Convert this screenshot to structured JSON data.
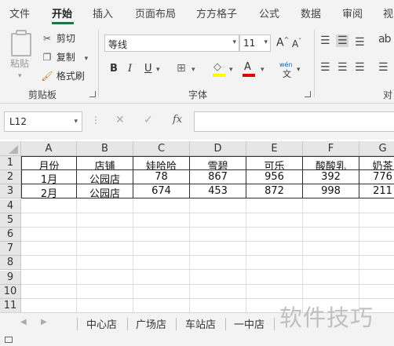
{
  "ribbon_tabs": [
    "文件",
    "开始",
    "插入",
    "页面布局",
    "方方格子",
    "公式",
    "数据",
    "审阅",
    "视"
  ],
  "clipboard": {
    "paste_label": "粘贴",
    "cut_label": "剪切",
    "copy_label": "复制",
    "format_painter_label": "格式刷",
    "group_label": "剪贴板"
  },
  "font": {
    "name": "等线",
    "size": "11",
    "group_label": "字体",
    "bold": "B",
    "italic": "I",
    "underline": "U",
    "grow": "A",
    "shrink": "A",
    "phonetic": "wén"
  },
  "alignment": {
    "group_label": "对"
  },
  "formula_bar": {
    "name_box": "L12",
    "fx_label": "fx",
    "value": ""
  },
  "sheet": {
    "columns": [
      "A",
      "B",
      "C",
      "D",
      "E",
      "F",
      "G"
    ],
    "rows": [
      "1",
      "2",
      "3",
      "4",
      "5",
      "6",
      "7",
      "8",
      "9",
      "10",
      "11"
    ],
    "table": [
      [
        "月份",
        "店铺",
        "娃哈哈",
        "雪碧",
        "可乐",
        "酸酸乳",
        "奶茶"
      ],
      [
        "1月",
        "公园店",
        "78",
        "867",
        "956",
        "392",
        "776"
      ],
      [
        "2月",
        "公园店",
        "674",
        "453",
        "872",
        "998",
        "211"
      ]
    ]
  },
  "sheet_tabs": [
    "中心店",
    "广场店",
    "车站店",
    "一中店"
  ],
  "watermark": "软件技巧"
}
